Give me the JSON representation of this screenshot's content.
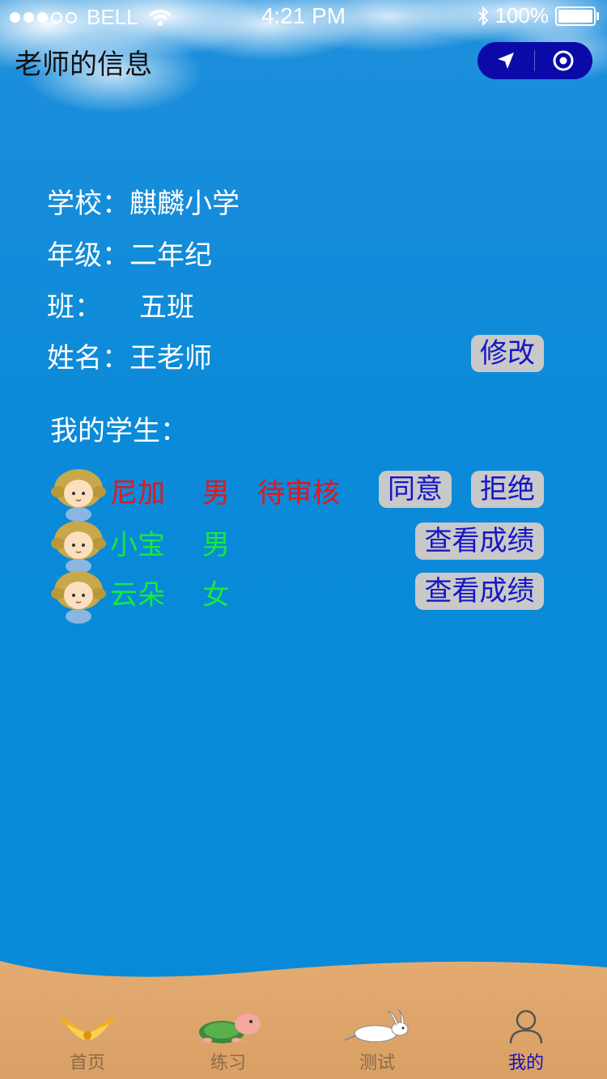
{
  "status_bar": {
    "carrier": "BELL",
    "time": "4:21 PM",
    "battery": "100%"
  },
  "nav": {
    "title": "老师的信息",
    "capsule_icons": [
      "navigation-arrow-icon",
      "target-circle-icon"
    ]
  },
  "teacher": {
    "school_label": "学校：",
    "school_value": "麒麟小学",
    "grade_label": "年级：",
    "grade_value": "二年纪",
    "class_label": "班：",
    "class_value": "五班",
    "name_label": "姓名：",
    "name_value": "王老师",
    "edit_button": "修改"
  },
  "students_section": {
    "title": "我的学生：",
    "students": [
      {
        "name": "尼加",
        "gender": "男",
        "status": "待审核",
        "color": "#e8141c",
        "actions": [
          "同意",
          "拒绝"
        ]
      },
      {
        "name": "小宝",
        "gender": "男",
        "status": "",
        "color": "#18e83c",
        "actions": [
          "查看成绩"
        ]
      },
      {
        "name": "云朵",
        "gender": "女",
        "status": "",
        "color": "#18e83c",
        "actions": [
          "查看成绩"
        ]
      }
    ]
  },
  "tab_bar": {
    "items": [
      {
        "label": "首页",
        "icon": "golden-wings-icon",
        "active": false
      },
      {
        "label": "练习",
        "icon": "turtle-icon",
        "active": false
      },
      {
        "label": "测试",
        "icon": "rabbit-icon",
        "active": false
      },
      {
        "label": "我的",
        "icon": "person-icon",
        "active": true
      }
    ],
    "active_color": "#1010c0",
    "inactive_color": "#8a6a48"
  },
  "colors": {
    "background": "#078ad9",
    "button_bg": "#c9c9c9",
    "button_text": "#1515c8",
    "capsule": "#0a0aa8"
  }
}
